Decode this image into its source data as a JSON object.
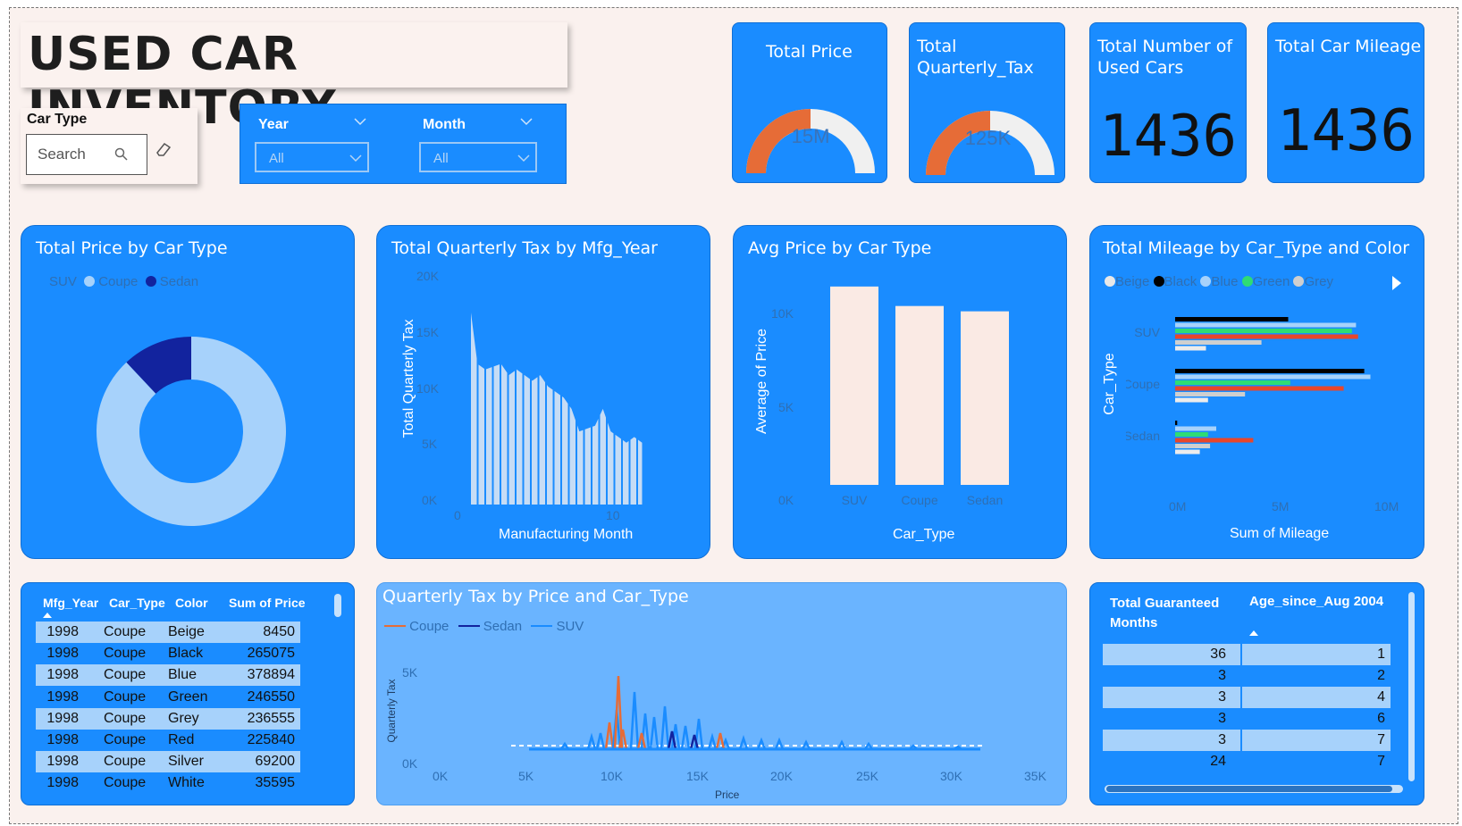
{
  "title": "USED CAR INVENTORY",
  "filters": {
    "car_type_label": "Car Type",
    "search_placeholder": "Search",
    "year_label": "Year",
    "year_value": "All",
    "month_label": "Month",
    "month_value": "All"
  },
  "kpis": {
    "total_price": {
      "title": "Total Price",
      "value": "15M",
      "fill": 0.45
    },
    "total_quarterly_tax": {
      "title": "Total Quarterly_Tax",
      "value": "125K",
      "fill": 0.45
    },
    "total_number": {
      "title": "Total Number of Used Cars",
      "value": "1436"
    },
    "total_mileage": {
      "title": "Total Car Mileage",
      "value": "1436"
    }
  },
  "donut": {
    "title": "Total Price by Car Type",
    "legend": [
      "SUV",
      "Coupe",
      "Sedan"
    ],
    "colors": {
      "SUV": "#1a8cff",
      "Coupe": "#a7d2fb",
      "Sedan": "#12239e"
    }
  },
  "tax_by_year": {
    "title": "Total Quarterly Tax by Mfg_Year",
    "ylabel": "Total Quarterly Tax",
    "xlabel": "Manufacturing Month",
    "yticks": [
      "20K",
      "15K",
      "10K",
      "5K",
      "0K"
    ],
    "xticks": [
      "0",
      "10"
    ]
  },
  "avg_price": {
    "title": "Avg Price by Car Type",
    "ylabel": "Average of Price",
    "xlabel": "Car_Type",
    "yticks": [
      "10K",
      "5K",
      "0K"
    ]
  },
  "mileage": {
    "title": "Total Mileage by Car_Type and Color",
    "legend": [
      "Beige",
      "Black",
      "Blue",
      "Green",
      "Grey"
    ],
    "ylabel": "Car_Type",
    "xlabel": "Sum of Mileage",
    "xticks": [
      "0M",
      "5M",
      "10M"
    ]
  },
  "table1": {
    "headers": [
      "Mfg_Year",
      "Car_Type",
      "Color",
      "Sum of Price"
    ],
    "rows": [
      [
        "1998",
        "Coupe",
        "Beige",
        "8450"
      ],
      [
        "1998",
        "Coupe",
        "Black",
        "265075"
      ],
      [
        "1998",
        "Coupe",
        "Blue",
        "378894"
      ],
      [
        "1998",
        "Coupe",
        "Green",
        "246550"
      ],
      [
        "1998",
        "Coupe",
        "Grey",
        "236555"
      ],
      [
        "1998",
        "Coupe",
        "Red",
        "225840"
      ],
      [
        "1998",
        "Coupe",
        "Silver",
        "69200"
      ],
      [
        "1998",
        "Coupe",
        "White",
        "35595"
      ]
    ]
  },
  "scatter_line": {
    "title": "Quarterly Tax by Price and Car_Type",
    "legend": [
      "Coupe",
      "Sedan",
      "SUV"
    ],
    "ylabel": "Quarterly Tax",
    "xlabel": "Price",
    "yticks": [
      "5K",
      "0K"
    ],
    "xticks": [
      "0K",
      "5K",
      "10K",
      "15K",
      "20K",
      "25K",
      "30K",
      "35K"
    ]
  },
  "table2": {
    "headers": [
      "Total Guaranteed Months",
      "Age_since_Aug 2004"
    ],
    "rows": [
      [
        "36",
        "1"
      ],
      [
        "3",
        "2"
      ],
      [
        "3",
        "4"
      ],
      [
        "3",
        "6"
      ],
      [
        "3",
        "7"
      ],
      [
        "24",
        "7"
      ]
    ]
  },
  "chart_data": [
    {
      "type": "pie",
      "title": "Total Price by Car Type",
      "categories": [
        "SUV",
        "Coupe",
        "Sedan"
      ],
      "values": [
        0,
        88,
        12
      ]
    },
    {
      "type": "area",
      "title": "Total Quarterly Tax by Mfg_Year",
      "xlabel": "Manufacturing Month",
      "ylabel": "Total Quarterly Tax",
      "ylim": [
        0,
        20000
      ],
      "x": [
        1,
        1.5,
        2,
        3,
        3.5,
        4,
        5,
        5.5,
        6,
        7,
        7.5,
        8,
        9,
        9.5,
        10,
        11,
        11.5,
        12
      ],
      "values": [
        18000,
        12500,
        12000,
        12500,
        11500,
        12000,
        11000,
        11500,
        10500,
        9500,
        8500,
        6500,
        7000,
        8500,
        6500,
        5500,
        6000,
        5500
      ]
    },
    {
      "type": "bar",
      "title": "Avg Price by Car Type",
      "categories": [
        "SUV",
        "Coupe",
        "Sedan"
      ],
      "values": [
        11200,
        10100,
        9800
      ],
      "xlabel": "Car_Type",
      "ylabel": "Average of Price",
      "ylim": [
        0,
        12000
      ]
    },
    {
      "type": "bar",
      "title": "Total Mileage by Car_Type and Color",
      "categories": [
        "SUV",
        "Coupe",
        "Sedan"
      ],
      "series": [
        {
          "name": "Black",
          "values": [
            5.5,
            9.2,
            0.1
          ]
        },
        {
          "name": "Blue",
          "values": [
            8.8,
            9.5,
            2.0
          ]
        },
        {
          "name": "Green",
          "values": [
            8.6,
            5.6,
            1.6
          ]
        },
        {
          "name": "Red",
          "values": [
            8.9,
            8.2,
            3.8
          ]
        },
        {
          "name": "Grey",
          "values": [
            4.2,
            3.4,
            1.7
          ]
        },
        {
          "name": "Beige",
          "values": [
            1.5,
            1.6,
            1.2
          ]
        }
      ],
      "xlabel": "Sum of Mileage",
      "ylabel": "Car_Type",
      "xlim": [
        0,
        10
      ]
    },
    {
      "type": "line",
      "title": "Quarterly Tax by Price and Car_Type",
      "xlabel": "Price",
      "ylabel": "Quarterly Tax",
      "xlim": [
        0,
        35000
      ],
      "ylim": [
        0,
        6000
      ]
    }
  ],
  "colors": {
    "tile_blue": "#1a8cff",
    "light_blue": "#a7d2fb",
    "dark_navy": "#12239e",
    "orange": "#e66c37",
    "cream": "#faf1ee"
  }
}
